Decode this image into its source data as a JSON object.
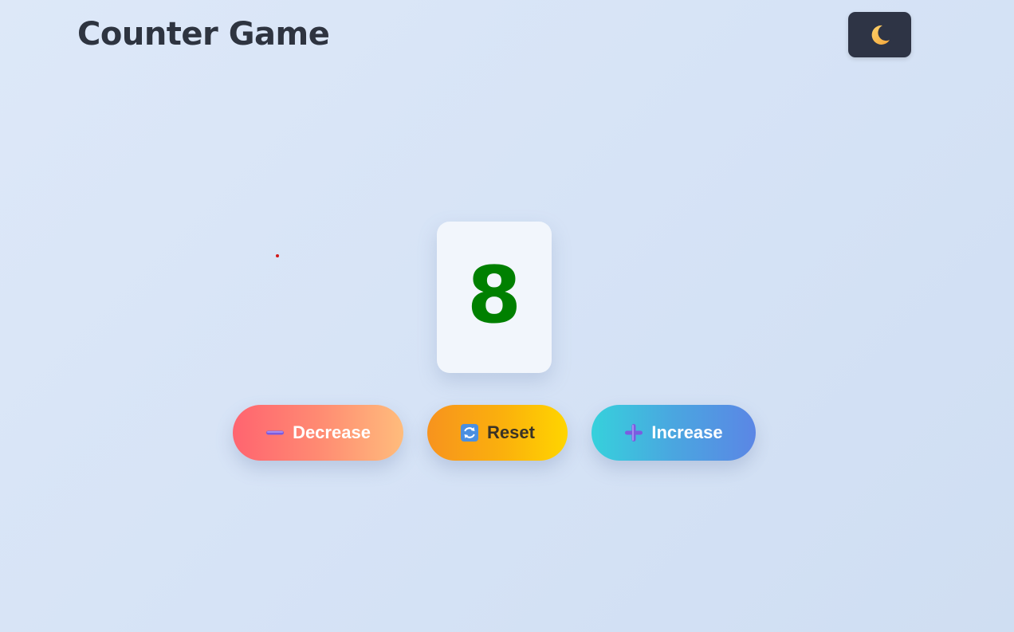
{
  "header": {
    "title": "Counter Game",
    "theme_toggle_icon": "moon-icon"
  },
  "counter": {
    "value": "8",
    "value_color": "#008000"
  },
  "controls": {
    "decrease": {
      "label": "Decrease",
      "icon": "minus-icon"
    },
    "reset": {
      "label": "Reset",
      "icon": "refresh-icon"
    },
    "increase": {
      "label": "Increase",
      "icon": "plus-icon"
    }
  },
  "colors": {
    "title": "#2e3440",
    "toggle_bg": "#2e3445",
    "decrease_gradient": [
      "#ff6470",
      "#ffbc7c"
    ],
    "reset_gradient": [
      "#f7931e",
      "#ffd500"
    ],
    "increase_gradient": [
      "#36d1dc",
      "#5b86e5"
    ]
  }
}
